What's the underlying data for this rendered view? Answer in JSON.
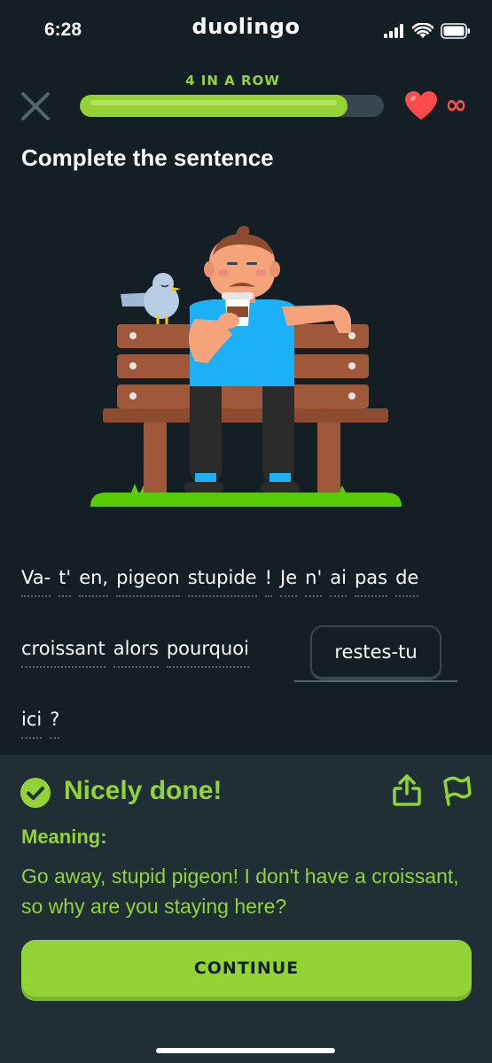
{
  "status_bar": {
    "time": "6:28",
    "brand": "duolingo"
  },
  "header": {
    "streak_label": "4 IN A ROW",
    "progress": 0.88,
    "hearts": "∞",
    "colors": {
      "accent": "#93d333",
      "heart": "#ff4b4b"
    }
  },
  "prompt": {
    "title": "Complete the sentence"
  },
  "sentence": {
    "line1": [
      "Va-",
      "t'",
      "en,",
      "pigeon",
      "stupide",
      "!",
      "Je",
      "n'",
      "ai",
      "pas",
      "de"
    ],
    "line2": [
      "croissant",
      "alors",
      "pourquoi"
    ],
    "answer": "restes-tu",
    "line3": [
      "ici",
      "?"
    ]
  },
  "feedback": {
    "title": "Nicely done!",
    "meaning_label": "Meaning:",
    "meaning": "Go away, stupid pigeon! I don't have a croissant, so why are you staying here?",
    "continue_label": "CONTINUE"
  }
}
